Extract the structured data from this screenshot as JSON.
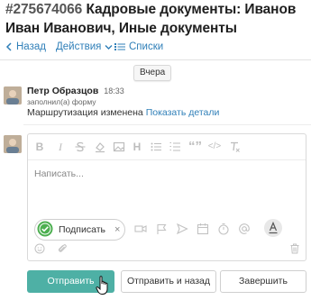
{
  "ticket": {
    "number": "#275674066",
    "title": "Кадровые документы: Иванов Иван Иванович, Иные документы"
  },
  "toolbar": {
    "back_label": "Назад",
    "actions_label": "Действия",
    "lists_label": "Списки"
  },
  "feed": {
    "date_label": "Вчера",
    "entry": {
      "author": "Петр Образцов",
      "time": "18:33",
      "note": "заполнил(а) форму",
      "message": "Маршрутизация изменена",
      "details_link": "Показать детали"
    }
  },
  "editor": {
    "placeholder": "Написать...",
    "sign_chip_label": "Подписать",
    "sign_chip_remove": "×",
    "formatting": [
      "bold-icon",
      "italic-icon",
      "strikethrough-icon",
      "paint-icon",
      "image-icon",
      "heading-icon",
      "bullet-list-icon",
      "numbered-list-icon",
      "quote-icon",
      "code-icon",
      "clear-format-icon"
    ],
    "format_glyphs": {
      "bold": "B",
      "italic": "I",
      "heading": "H",
      "quote": "“”",
      "code": "</>"
    }
  },
  "buttons": {
    "send": "Отправить",
    "send_back": "Отправить и назад",
    "finish": "Завершить"
  },
  "colors": {
    "accent": "#2f7fb8",
    "primary_button": "#4eb0a5",
    "sign_check": "#4caf50"
  }
}
